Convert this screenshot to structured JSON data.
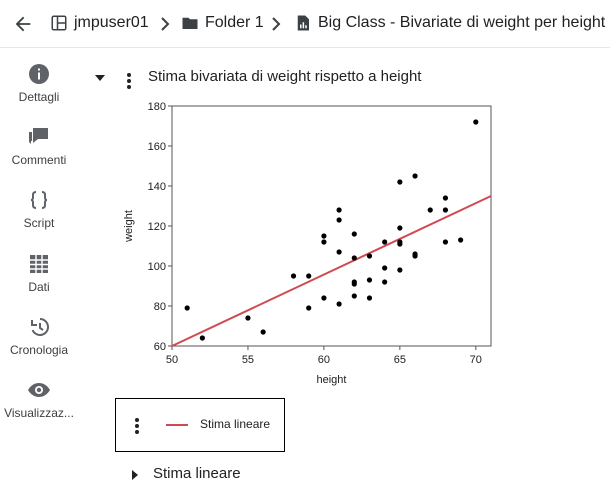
{
  "breadcrumb": {
    "items": [
      {
        "label": "jmpuser01",
        "icon": "grid-icon"
      },
      {
        "label": "Folder 1",
        "icon": "folder-icon"
      },
      {
        "label": "Big Class - Bivariate di weight per height",
        "icon": "report-icon"
      }
    ]
  },
  "sidebar": {
    "items": [
      {
        "label": "Dettagli",
        "icon": "info-icon"
      },
      {
        "label": "Commenti",
        "icon": "comment-icon"
      },
      {
        "label": "Script",
        "icon": "braces-icon"
      },
      {
        "label": "Dati",
        "icon": "table-icon"
      },
      {
        "label": "Cronologia",
        "icon": "history-icon"
      },
      {
        "label": "Visualizzaz...",
        "icon": "eye-icon"
      }
    ]
  },
  "section": {
    "title": "Stima bivariata di weight rispetto a height",
    "subsection": "Stima lineare"
  },
  "legend": {
    "label": "Stima lineare"
  },
  "colors": {
    "fit_line": "#d04a51",
    "points": "#000000",
    "icons": "#5f6368"
  },
  "chart_data": {
    "type": "scatter",
    "xlabel": "height",
    "ylabel": "weight",
    "xlim": [
      50,
      71
    ],
    "ylim": [
      60,
      180
    ],
    "xticks": [
      50,
      55,
      60,
      65,
      70
    ],
    "yticks": [
      60,
      80,
      100,
      120,
      140,
      160,
      180
    ],
    "points": [
      [
        51,
        79
      ],
      [
        52,
        64
      ],
      [
        55,
        74
      ],
      [
        56,
        67
      ],
      [
        58,
        95
      ],
      [
        59,
        95
      ],
      [
        59,
        79
      ],
      [
        60,
        112
      ],
      [
        60,
        115
      ],
      [
        60,
        84
      ],
      [
        61,
        128
      ],
      [
        61,
        123
      ],
      [
        61,
        107
      ],
      [
        61,
        81
      ],
      [
        62,
        116
      ],
      [
        62,
        104
      ],
      [
        62,
        92
      ],
      [
        62,
        91
      ],
      [
        62,
        85
      ],
      [
        63,
        105
      ],
      [
        63,
        93
      ],
      [
        63,
        84
      ],
      [
        64,
        112
      ],
      [
        64,
        99
      ],
      [
        64,
        92
      ],
      [
        65,
        142
      ],
      [
        65,
        119
      ],
      [
        65,
        112
      ],
      [
        65,
        111
      ],
      [
        65,
        98
      ],
      [
        66,
        145
      ],
      [
        66,
        106
      ],
      [
        66,
        105
      ],
      [
        67,
        128
      ],
      [
        68,
        134
      ],
      [
        68,
        128
      ],
      [
        68,
        112
      ],
      [
        69,
        113
      ],
      [
        70,
        172
      ]
    ],
    "fit": {
      "name": "Stima lineare",
      "x": [
        50,
        71
      ],
      "y": [
        59,
        135
      ]
    }
  }
}
